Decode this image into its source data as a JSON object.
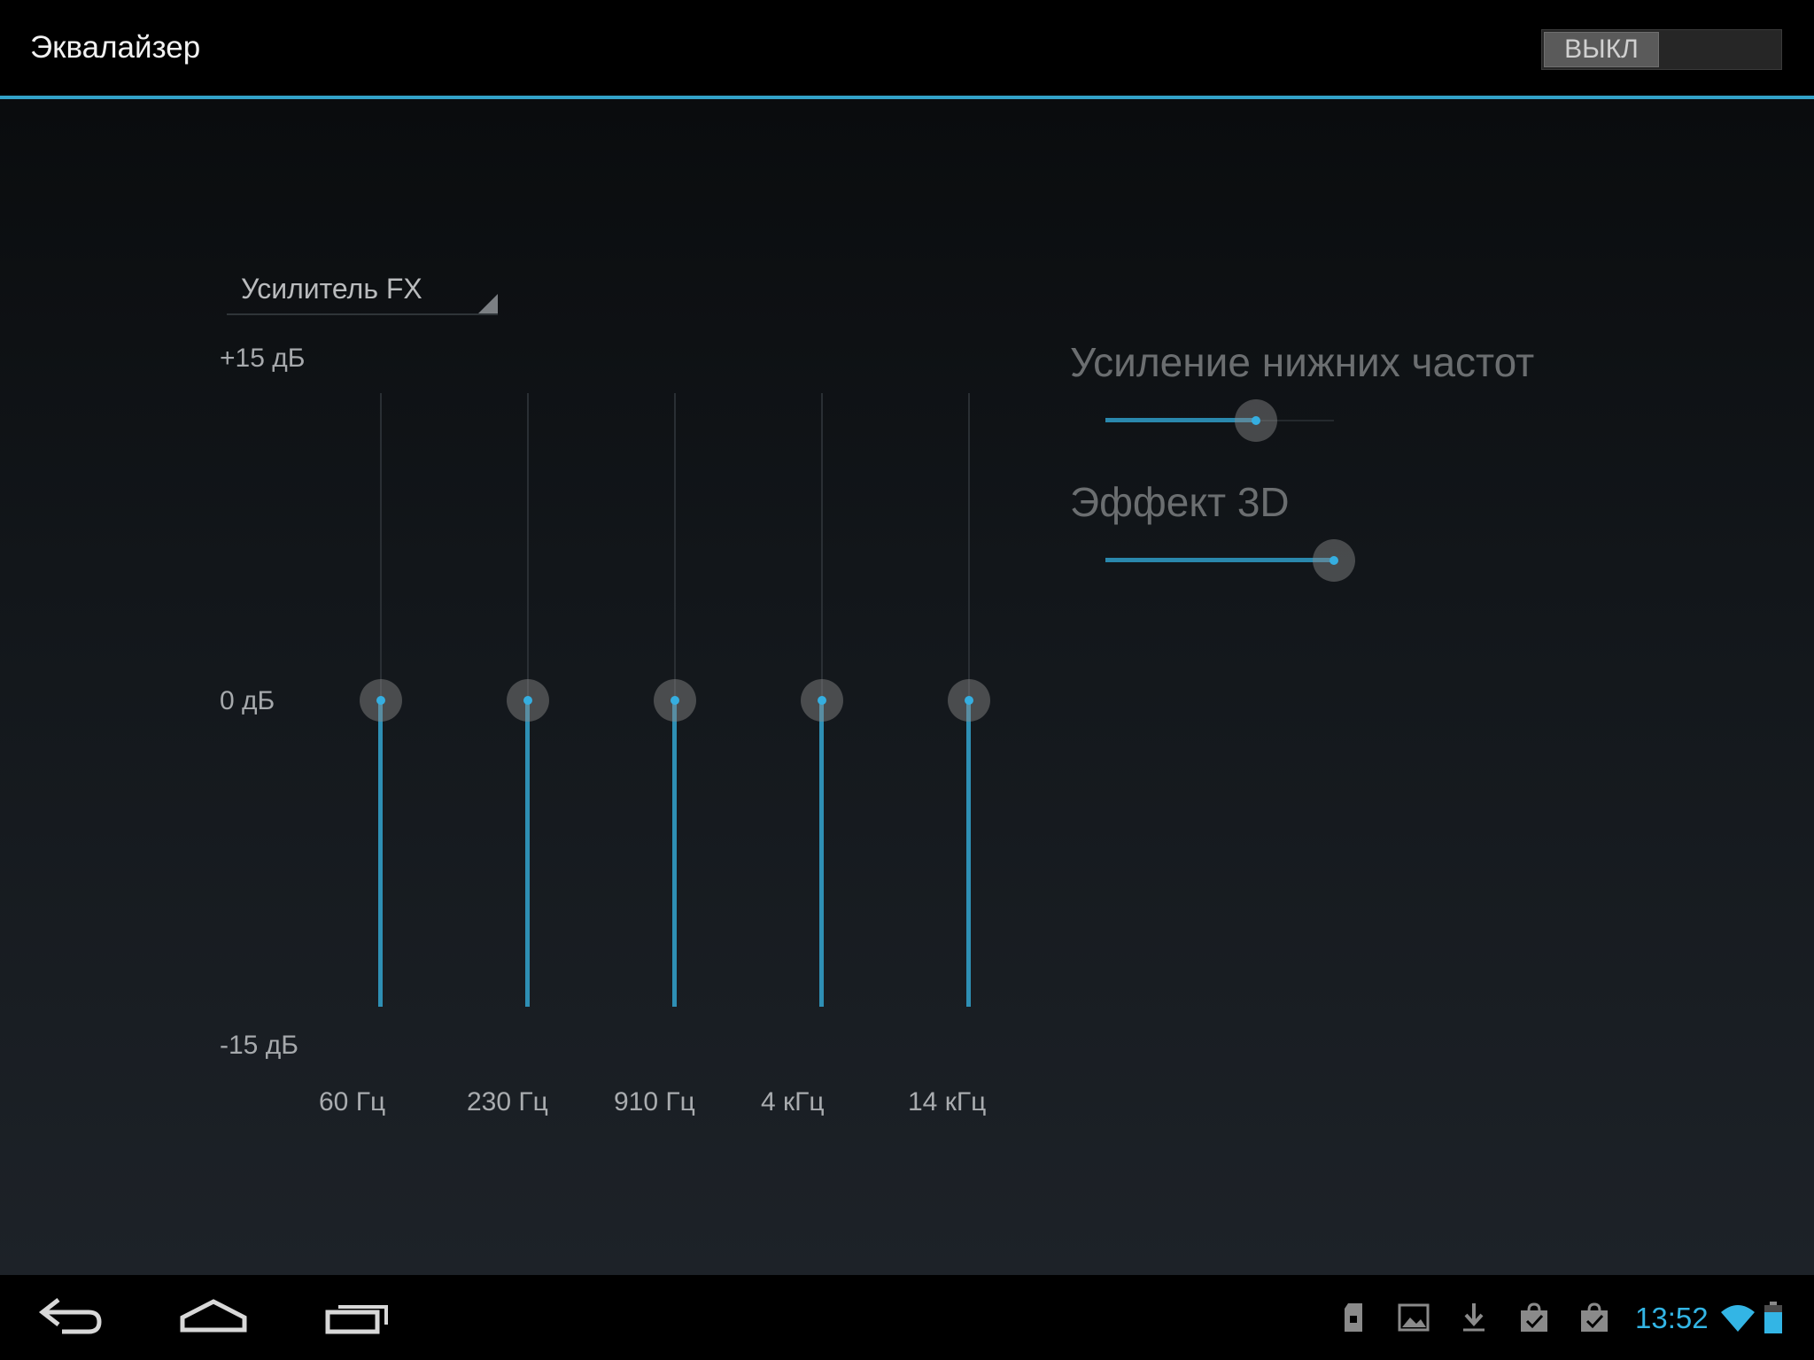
{
  "action_bar": {
    "title": "Эквалайзер",
    "power_toggle": {
      "state_label": "ВЫКЛ",
      "on": false
    }
  },
  "equalizer": {
    "preset": "Усилитель FX",
    "db_labels": {
      "max": "+15 дБ",
      "mid": "0 дБ",
      "min": "-15 дБ"
    },
    "range_db": [
      -15,
      15
    ],
    "bands": [
      {
        "label": "60 Гц",
        "gain_db": 0
      },
      {
        "label": "230 Гц",
        "gain_db": 0
      },
      {
        "label": "910 Гц",
        "gain_db": 0
      },
      {
        "label": "4 кГц",
        "gain_db": 0
      },
      {
        "label": "14 кГц",
        "gain_db": 0
      }
    ]
  },
  "effects": {
    "bass_boost": {
      "title": "Усиление нижних частот",
      "level": 0.66
    },
    "virtualizer": {
      "title": "Эффект 3D",
      "level": 1.0
    }
  },
  "system_bar": {
    "clock": "13:52",
    "accent_color": "#33b5e5",
    "nav_icons": [
      "back-icon",
      "home-icon",
      "recent-apps-icon"
    ],
    "notification_icons": [
      "sd-card-icon",
      "gallery-icon",
      "download-icon",
      "play-store-update-icon",
      "play-store-update-icon"
    ],
    "status_icons": [
      "wifi-icon",
      "battery-icon"
    ]
  }
}
